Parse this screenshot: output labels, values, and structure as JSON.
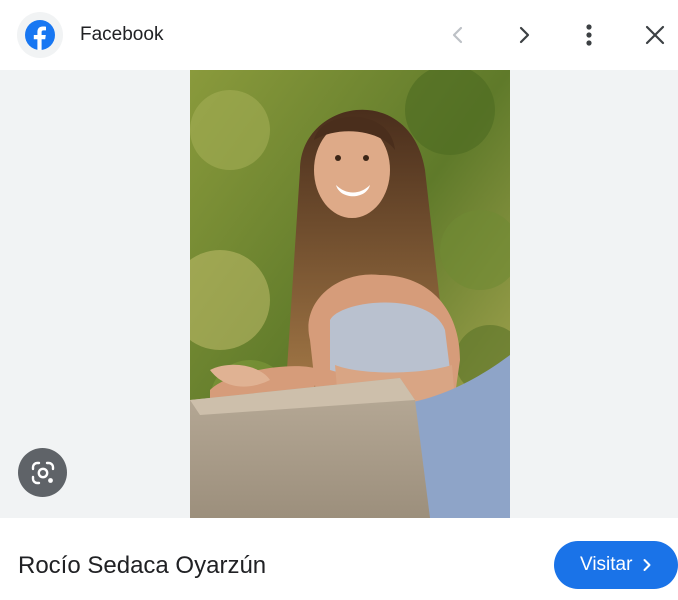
{
  "header": {
    "source_name": "Facebook",
    "icons": {
      "source": "facebook-logo-icon",
      "prev": "chevron-left-icon",
      "next": "chevron-right-icon",
      "more": "more-vert-icon",
      "close": "close-icon"
    }
  },
  "image": {
    "lens_icon": "google-lens-icon"
  },
  "footer": {
    "title": "Rocío Sedaca Oyarzún",
    "visit_label": "Visitar"
  },
  "colors": {
    "accent": "#1a73e8",
    "facebook_blue": "#1877f2",
    "background": "#f1f3f4",
    "icon_grey": "#5f6368",
    "disabled_grey": "#bdc1c6"
  }
}
